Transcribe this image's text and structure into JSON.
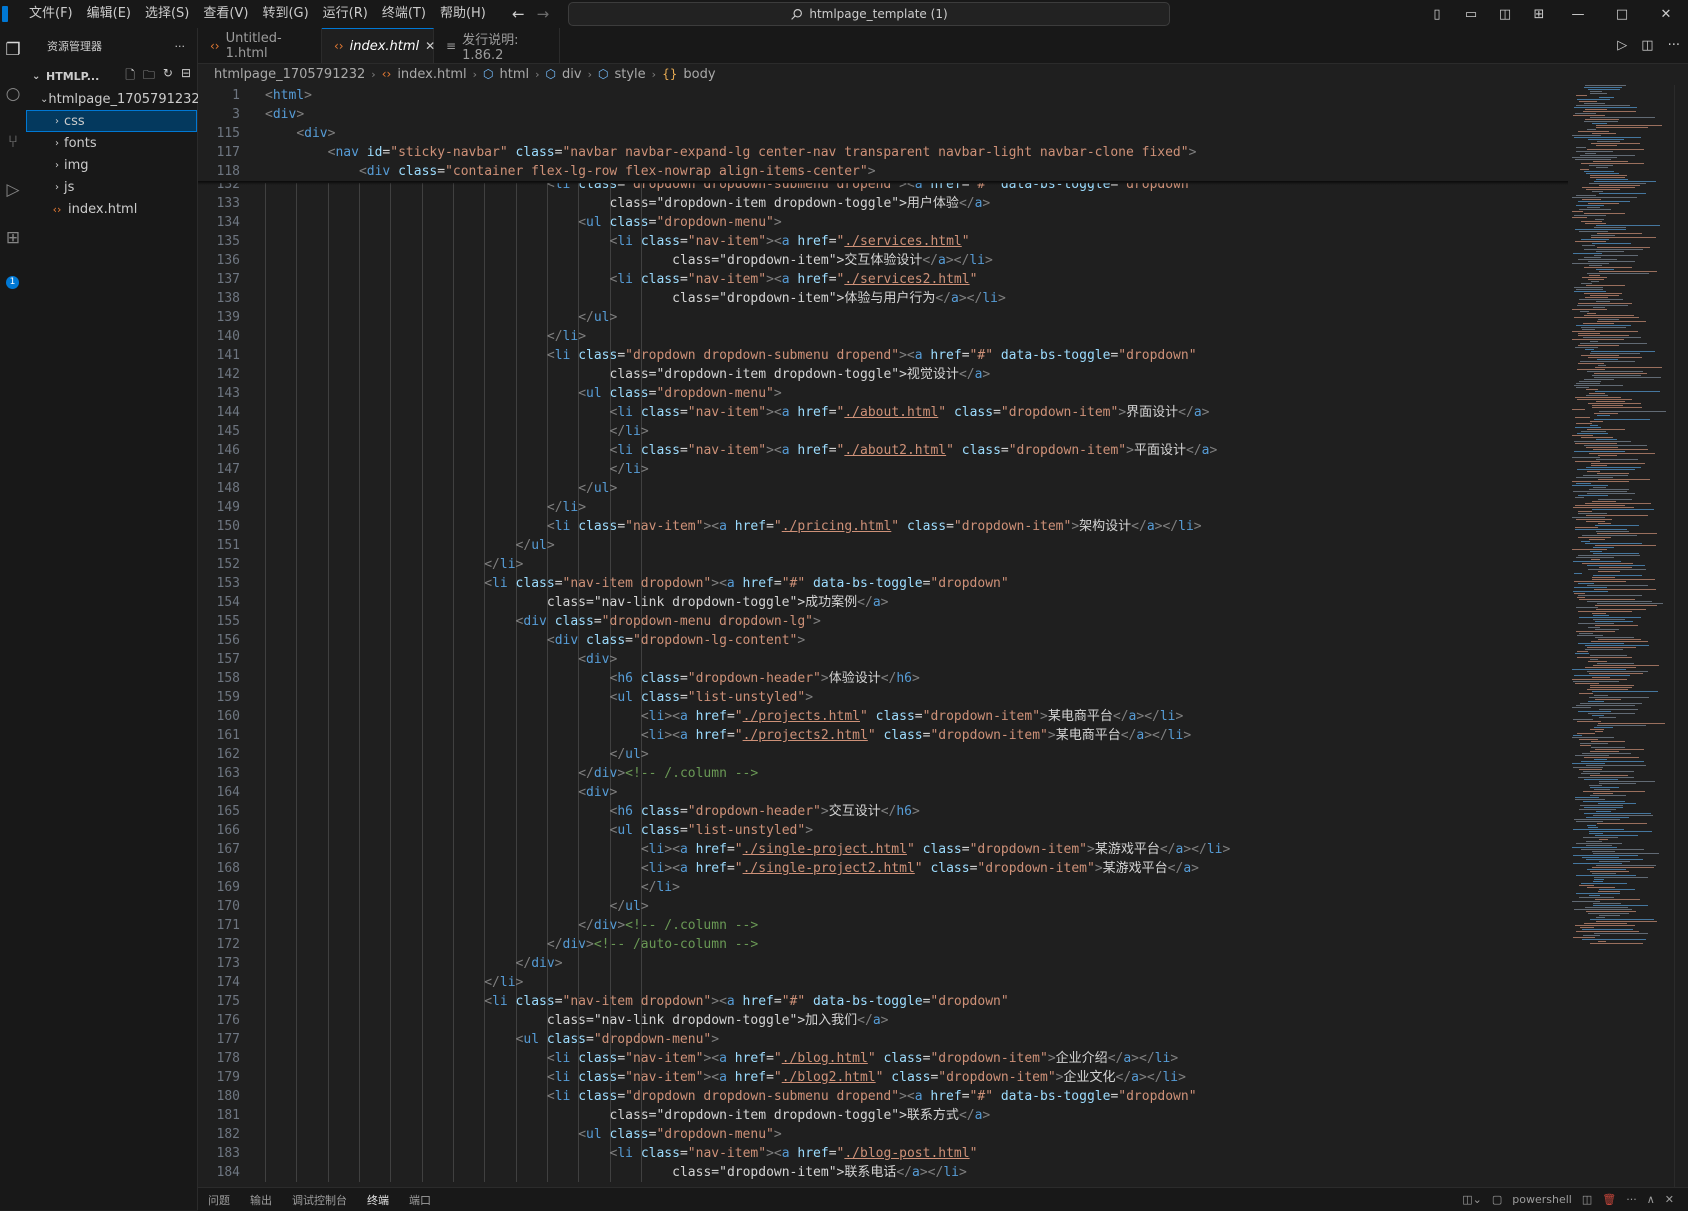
{
  "menu": [
    "文件(F)",
    "编辑(E)",
    "选择(S)",
    "查看(V)",
    "转到(G)",
    "运行(R)",
    "终端(T)",
    "帮助(H)"
  ],
  "command_center": "htmlpage_template (1)",
  "sidebar": {
    "title": "资源管理器",
    "section": "HTMLP...",
    "root_folder": "htmlpage_1705791232",
    "items": [
      {
        "label": "css",
        "type": "folder",
        "selected": true
      },
      {
        "label": "fonts",
        "type": "folder"
      },
      {
        "label": "img",
        "type": "folder"
      },
      {
        "label": "js",
        "type": "folder"
      },
      {
        "label": "index.html",
        "type": "file"
      }
    ]
  },
  "activity_badge": "1",
  "tabs": [
    {
      "label": "Untitled-1.html",
      "icon": "html-icon"
    },
    {
      "label": "index.html",
      "icon": "html-icon",
      "active": true
    },
    {
      "label": "发行说明: 1.86.2",
      "icon": "release-notes-icon"
    }
  ],
  "breadcrumb": [
    "htmlpage_1705791232",
    "index.html",
    "html",
    "div",
    "style",
    "body"
  ],
  "sticky_lines": [
    {
      "n": "1",
      "indent": 0,
      "code": "<html>"
    },
    {
      "n": "3",
      "indent": 0,
      "code": "<div>"
    },
    {
      "n": "115",
      "indent": 1,
      "code": "<div>"
    },
    {
      "n": "117",
      "indent": 2,
      "code": "<nav id=\"sticky-navbar\" class=\"navbar navbar-expand-lg center-nav transparent navbar-light navbar-clone fixed\">"
    },
    {
      "n": "118",
      "indent": 3,
      "code": "<div class=\"container flex-lg-row flex-nowrap align-items-center\">"
    }
  ],
  "code_lines": [
    {
      "n": "132",
      "indent": 9,
      "code": "<li class=\"dropdown dropdown-submenu dropend\"><a href=\"#\" data-bs-toggle=\"dropdown\""
    },
    {
      "n": "133",
      "indent": 11,
      "code": "class=\"dropdown-item dropdown-toggle\">用户体验</a>"
    },
    {
      "n": "134",
      "indent": 10,
      "code": "<ul class=\"dropdown-menu\">"
    },
    {
      "n": "135",
      "indent": 11,
      "code": "<li class=\"nav-item\"><a href=\"./services.html\""
    },
    {
      "n": "136",
      "indent": 13,
      "code": "class=\"dropdown-item\">交互体验设计</a></li>"
    },
    {
      "n": "137",
      "indent": 11,
      "code": "<li class=\"nav-item\"><a href=\"./services2.html\""
    },
    {
      "n": "138",
      "indent": 13,
      "code": "class=\"dropdown-item\">体验与用户行为</a></li>"
    },
    {
      "n": "139",
      "indent": 10,
      "code": "</ul>"
    },
    {
      "n": "140",
      "indent": 9,
      "code": "</li>"
    },
    {
      "n": "141",
      "indent": 9,
      "code": "<li class=\"dropdown dropdown-submenu dropend\"><a href=\"#\" data-bs-toggle=\"dropdown\""
    },
    {
      "n": "142",
      "indent": 11,
      "code": "class=\"dropdown-item dropdown-toggle\">视觉设计</a>"
    },
    {
      "n": "143",
      "indent": 10,
      "code": "<ul class=\"dropdown-menu\">"
    },
    {
      "n": "144",
      "indent": 11,
      "code": "<li class=\"nav-item\"><a href=\"./about.html\" class=\"dropdown-item\">界面设计</a>"
    },
    {
      "n": "145",
      "indent": 11,
      "code": "</li>"
    },
    {
      "n": "146",
      "indent": 11,
      "code": "<li class=\"nav-item\"><a href=\"./about2.html\" class=\"dropdown-item\">平面设计</a>"
    },
    {
      "n": "147",
      "indent": 11,
      "code": "</li>"
    },
    {
      "n": "148",
      "indent": 10,
      "code": "</ul>"
    },
    {
      "n": "149",
      "indent": 9,
      "code": "</li>"
    },
    {
      "n": "150",
      "indent": 9,
      "code": "<li class=\"nav-item\"><a href=\"./pricing.html\" class=\"dropdown-item\">架构设计</a></li>"
    },
    {
      "n": "151",
      "indent": 8,
      "code": "</ul>"
    },
    {
      "n": "152",
      "indent": 7,
      "code": "</li>"
    },
    {
      "n": "153",
      "indent": 7,
      "code": "<li class=\"nav-item dropdown\"><a href=\"#\" data-bs-toggle=\"dropdown\""
    },
    {
      "n": "154",
      "indent": 9,
      "code": "class=\"nav-link dropdown-toggle\">成功案例</a>"
    },
    {
      "n": "155",
      "indent": 8,
      "code": "<div class=\"dropdown-menu dropdown-lg\">"
    },
    {
      "n": "156",
      "indent": 9,
      "code": "<div class=\"dropdown-lg-content\">"
    },
    {
      "n": "157",
      "indent": 10,
      "code": "<div>"
    },
    {
      "n": "158",
      "indent": 11,
      "code": "<h6 class=\"dropdown-header\">体验设计</h6>"
    },
    {
      "n": "159",
      "indent": 11,
      "code": "<ul class=\"list-unstyled\">"
    },
    {
      "n": "160",
      "indent": 12,
      "code": "<li><a href=\"./projects.html\" class=\"dropdown-item\">某电商平台</a></li>"
    },
    {
      "n": "161",
      "indent": 12,
      "code": "<li><a href=\"./projects2.html\" class=\"dropdown-item\">某电商平台</a></li>"
    },
    {
      "n": "162",
      "indent": 11,
      "code": "</ul>"
    },
    {
      "n": "163",
      "indent": 10,
      "code": "</div><!-- /.column -->"
    },
    {
      "n": "164",
      "indent": 10,
      "code": "<div>"
    },
    {
      "n": "165",
      "indent": 11,
      "code": "<h6 class=\"dropdown-header\">交互设计</h6>"
    },
    {
      "n": "166",
      "indent": 11,
      "code": "<ul class=\"list-unstyled\">"
    },
    {
      "n": "167",
      "indent": 12,
      "code": "<li><a href=\"./single-project.html\" class=\"dropdown-item\">某游戏平台</a></li>"
    },
    {
      "n": "168",
      "indent": 12,
      "code": "<li><a href=\"./single-project2.html\" class=\"dropdown-item\">某游戏平台</a>"
    },
    {
      "n": "169",
      "indent": 12,
      "code": "</li>"
    },
    {
      "n": "170",
      "indent": 11,
      "code": "</ul>"
    },
    {
      "n": "171",
      "indent": 10,
      "code": "</div><!-- /.column -->"
    },
    {
      "n": "172",
      "indent": 9,
      "code": "</div><!-- /auto-column -->"
    },
    {
      "n": "173",
      "indent": 8,
      "code": "</div>"
    },
    {
      "n": "174",
      "indent": 7,
      "code": "</li>"
    },
    {
      "n": "175",
      "indent": 7,
      "code": "<li class=\"nav-item dropdown\"><a href=\"#\" data-bs-toggle=\"dropdown\""
    },
    {
      "n": "176",
      "indent": 9,
      "code": "class=\"nav-link dropdown-toggle\">加入我们</a>"
    },
    {
      "n": "177",
      "indent": 8,
      "code": "<ul class=\"dropdown-menu\">"
    },
    {
      "n": "178",
      "indent": 9,
      "code": "<li class=\"nav-item\"><a href=\"./blog.html\" class=\"dropdown-item\">企业介绍</a></li>"
    },
    {
      "n": "179",
      "indent": 9,
      "code": "<li class=\"nav-item\"><a href=\"./blog2.html\" class=\"dropdown-item\">企业文化</a></li>"
    },
    {
      "n": "180",
      "indent": 9,
      "code": "<li class=\"dropdown dropdown-submenu dropend\"><a href=\"#\" data-bs-toggle=\"dropdown\""
    },
    {
      "n": "181",
      "indent": 11,
      "code": "class=\"dropdown-item dropdown-toggle\">联系方式</a>"
    },
    {
      "n": "182",
      "indent": 10,
      "code": "<ul class=\"dropdown-menu\">"
    },
    {
      "n": "183",
      "indent": 11,
      "code": "<li class=\"nav-item\"><a href=\"./blog-post.html\""
    },
    {
      "n": "184",
      "indent": 13,
      "code": "class=\"dropdown-item\">联系电话</a></li>"
    }
  ],
  "panel_tabs": [
    "问题",
    "输出",
    "调试控制台",
    "终端",
    "端口"
  ],
  "panel_active": "终端",
  "terminal_name": "powershell",
  "colors": {
    "accent": "#0078d4",
    "tag": "#569cd6",
    "attr": "#9cdcfe",
    "value": "#ce9178",
    "comment": "#6a9955"
  }
}
